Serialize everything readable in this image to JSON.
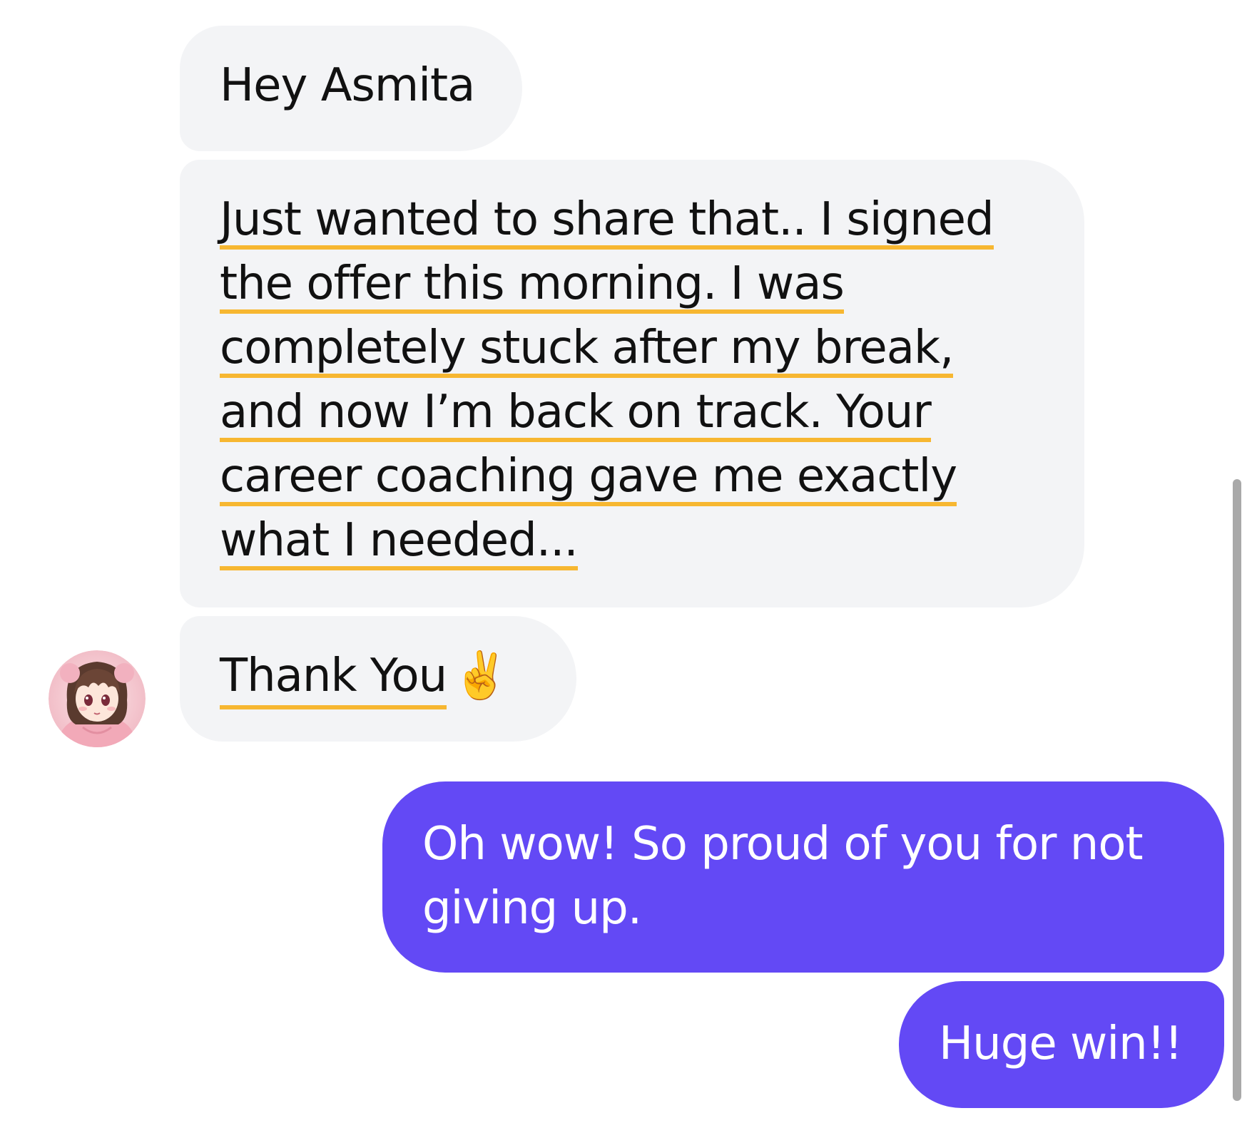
{
  "messages": [
    {
      "direction": "incoming",
      "lines": [
        "Hey Asmita"
      ]
    },
    {
      "direction": "incoming",
      "lines": [
        "Just wanted to share that.. I signed",
        "the offer this morning. I was",
        "completely stuck after my break,",
        "and now I’m back on track. Your",
        "career coaching gave me exactly",
        "what I needed..."
      ]
    },
    {
      "direction": "incoming",
      "lines": [
        "Thank You"
      ],
      "emoji": "✌️"
    },
    {
      "direction": "outgoing",
      "lines": [
        "Oh wow! So proud of you for not",
        "giving up."
      ]
    },
    {
      "direction": "outgoing",
      "lines": [
        "Huge win!!"
      ]
    }
  ],
  "colors": {
    "incoming_bubble": "#f3f4f6",
    "outgoing_bubble": "#6349f5",
    "highlight_underline": "#f7b731",
    "scrollbar": "#a9a9a9"
  },
  "icons": {
    "avatar": "anime-girl-avatar",
    "emoji": "victory-hand"
  }
}
